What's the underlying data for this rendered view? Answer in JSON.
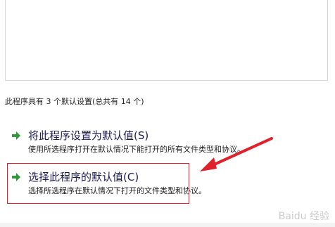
{
  "summary_text": "此程序具有 3 个默认设置(总共有 14 个)",
  "options": [
    {
      "title": "将此程序设置为默认值(S)",
      "description": "使用所选程序打开在默认情况下能打开的所有文件类型和协议。"
    },
    {
      "title": "选择此程序的默认值(C)",
      "description": "选择所选程序在默认情况下打开的文件类型和协议。"
    }
  ],
  "watermark": "Baidu 经验",
  "colors": {
    "arrow_green": "#2f9a3a",
    "highlight_red": "#e0202a",
    "title_blue": "#1a1a55"
  },
  "icons": [
    "green-arrow-icon",
    "red-annotation-arrow"
  ]
}
